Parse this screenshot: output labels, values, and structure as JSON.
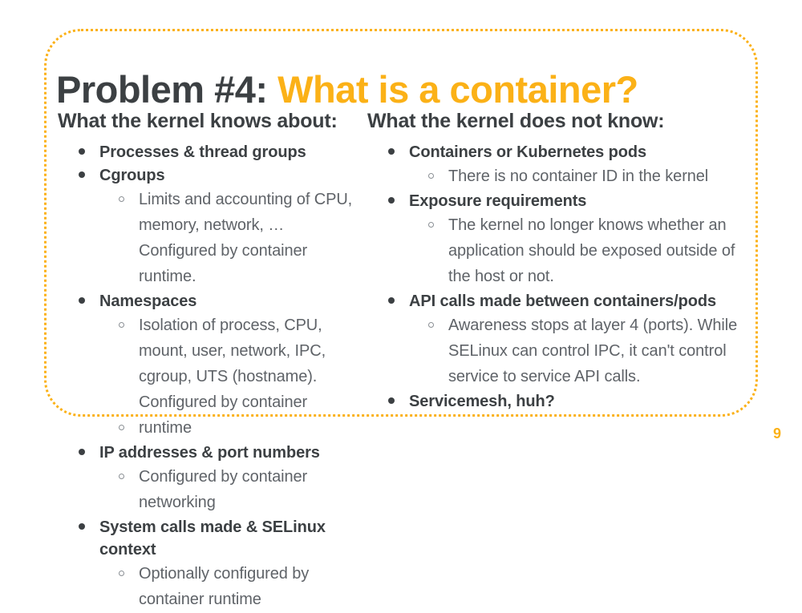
{
  "theme": {
    "accent": "#FBB117",
    "heading_color": "#3C4043",
    "body_color": "#5F6368",
    "background": "#ffffff"
  },
  "title": {
    "prefix": "Problem #4:",
    "highlight": "What is a container?"
  },
  "columns": [
    {
      "heading": "What the kernel knows about:",
      "items": [
        {
          "label": "Processes & thread groups",
          "subitems": []
        },
        {
          "label": "Cgroups",
          "subitems": [
            "Limits and accounting of CPU, memory, network, … Configured by container runtime."
          ]
        },
        {
          "label": "Namespaces",
          "subitems": [
            "Isolation of process, CPU, mount, user, network, IPC, cgroup, UTS (hostname). Configured by container",
            "runtime"
          ]
        },
        {
          "label": "IP addresses & port numbers",
          "subitems": [
            "Configured by container networking"
          ]
        },
        {
          "label": "System calls made & SELinux context",
          "subitems": [
            "Optionally configured by container runtime"
          ]
        }
      ]
    },
    {
      "heading": "What the kernel does not know:",
      "items": [
        {
          "label": "Containers or Kubernetes pods",
          "subitems": [
            "There is no container ID in the kernel"
          ]
        },
        {
          "label": "Exposure requirements",
          "subitems": [
            "The kernel no longer knows whether an application should be exposed outside of the host or not."
          ]
        },
        {
          "label": "API calls made between containers/pods",
          "subitems": [
            "Awareness stops at layer 4 (ports). While SELinux can control IPC, it can't control service to service API calls."
          ]
        },
        {
          "label": "Servicemesh, huh?",
          "subitems": []
        }
      ]
    }
  ],
  "page_number": "9"
}
